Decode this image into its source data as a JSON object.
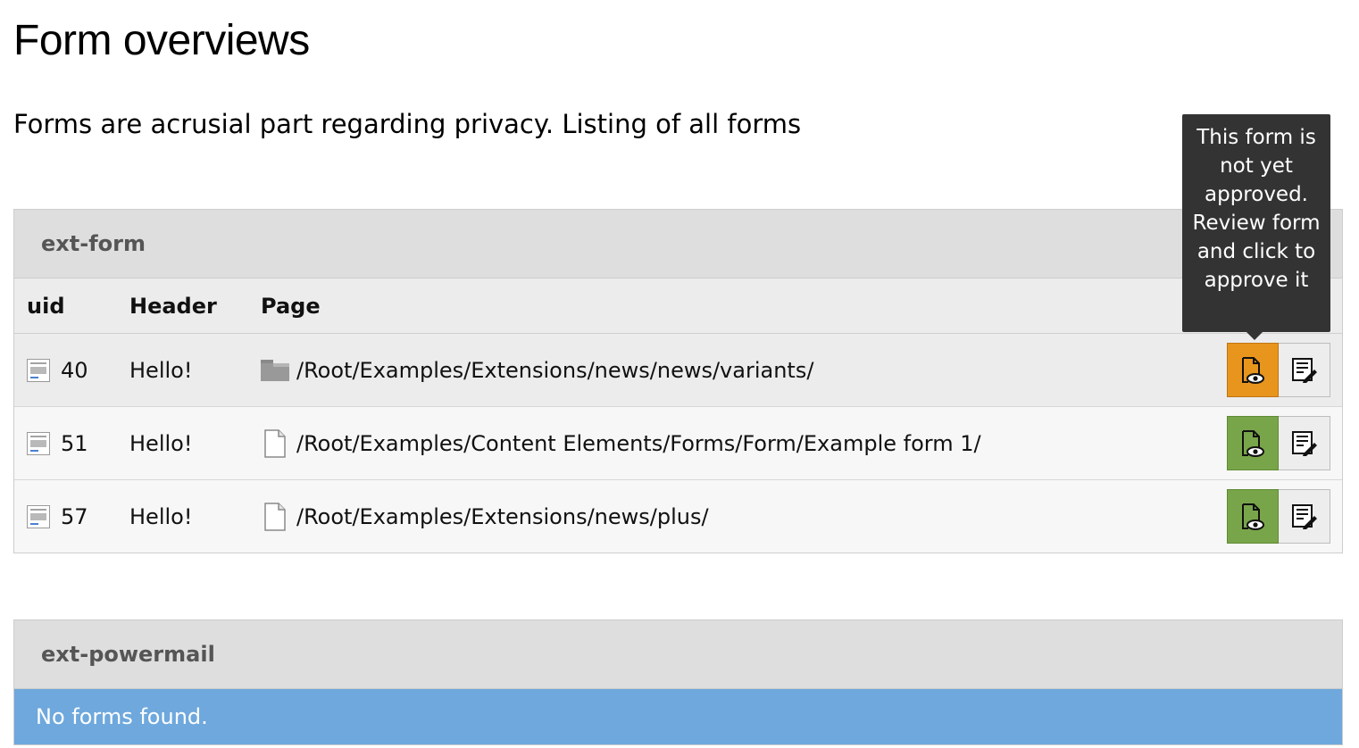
{
  "page": {
    "title": "Form overviews",
    "intro": "Forms are acrusial part regarding privacy. Listing of all forms"
  },
  "tooltip": {
    "text": "This form is not yet approved. Review form and click to approve it"
  },
  "panels": [
    {
      "heading": "ext-form",
      "columns": {
        "uid": "uid",
        "header": "Header",
        "page": "Page"
      },
      "rows": [
        {
          "uid": "40",
          "header": "Hello!",
          "page": "/Root/Examples/Extensions/news/news/variants/",
          "page_icon": "folder-icon",
          "status": "not-approved",
          "status_color": "#e8951e"
        },
        {
          "uid": "51",
          "header": "Hello!",
          "page": "/Root/Examples/Content Elements/Forms/Form/Example form 1/",
          "page_icon": "page-icon",
          "status": "approved",
          "status_color": "#79a54a"
        },
        {
          "uid": "57",
          "header": "Hello!",
          "page": "/Root/Examples/Extensions/news/plus/",
          "page_icon": "page-icon",
          "status": "approved",
          "status_color": "#79a54a"
        }
      ]
    },
    {
      "heading": "ext-powermail",
      "empty_message": "No forms found."
    }
  ],
  "icons": {
    "row_icon": "content-element-icon",
    "review_button": "document-eye-icon",
    "edit_button": "edit-document-icon"
  },
  "colors": {
    "warning": "#e8951e",
    "success": "#79a54a",
    "info": "#6ea8dd"
  }
}
